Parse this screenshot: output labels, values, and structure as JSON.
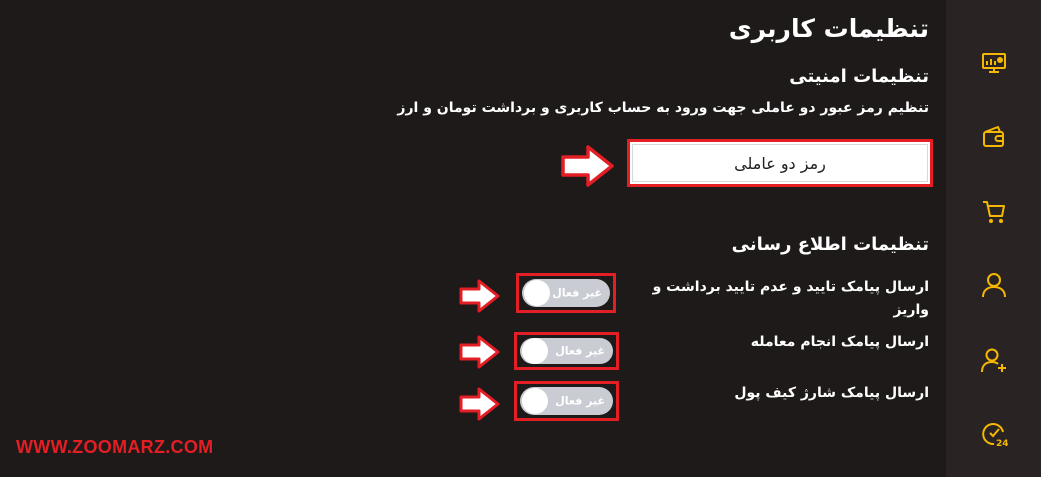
{
  "page_title": "تنظیمات کاربری",
  "security": {
    "title": "تنظیمات امنیتی",
    "description": "تنظیم رمز عبور دو عاملی جهت ورود به حساب کاربری و برداشت تومان و ارز",
    "two_factor_button": "رمز دو عاملی"
  },
  "notifications": {
    "title": "تنظیمات اطلاع رسانی",
    "items": [
      {
        "label": "ارسال پیامک تایید و عدم تایید برداشت و واریز",
        "toggle_text": "غیر فعال"
      },
      {
        "label": "ارسال پیامک انجام معامله",
        "toggle_text": "غیر فعال"
      },
      {
        "label": "ارسال پیامک شارژ کیف پول",
        "toggle_text": "غیر فعال"
      }
    ]
  },
  "sidebar": {
    "icons": [
      "dashboard-icon",
      "wallet-icon",
      "cart-icon",
      "user-icon",
      "user-add-icon",
      "support-24-icon"
    ]
  },
  "watermark": "WWW.ZOOMARZ.COM",
  "colors": {
    "accent": "#f5b800",
    "highlight": "#e31e24",
    "background": "#1e1a19",
    "sidebar": "#292423",
    "toggle_off": "#c9ccd3"
  }
}
